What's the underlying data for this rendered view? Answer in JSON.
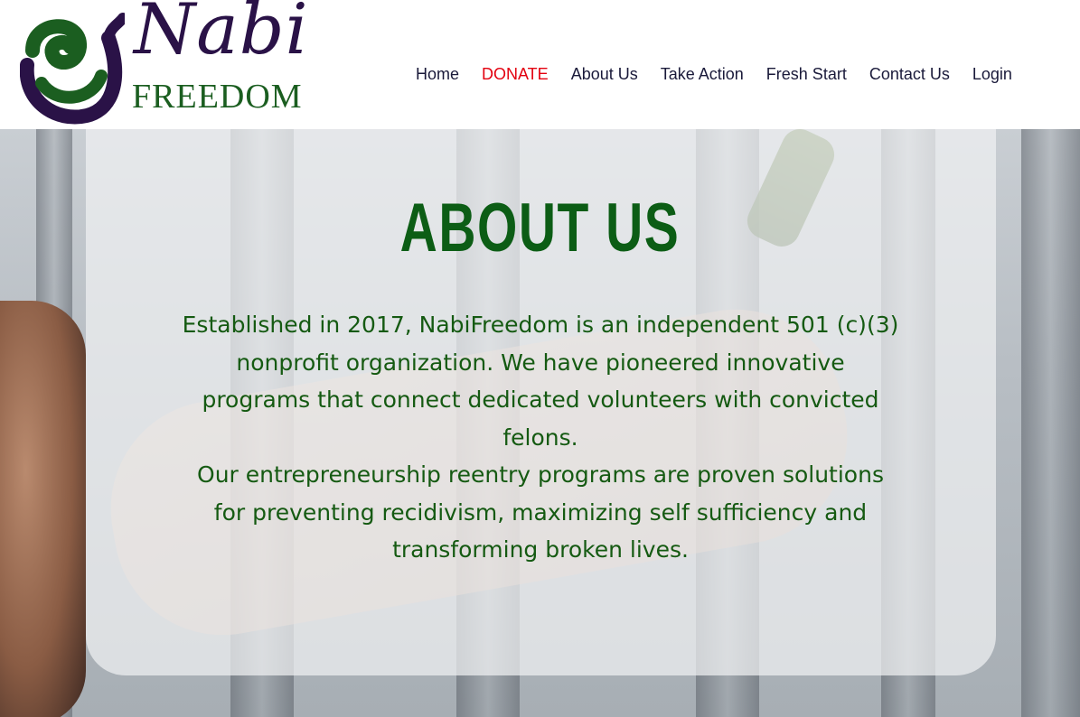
{
  "header": {
    "logo": {
      "name_top": "Nabi",
      "name_bottom": "FREEDOM"
    },
    "nav": [
      {
        "label": "Home",
        "color": "#1a1a3a"
      },
      {
        "label": "DONATE",
        "color": "#e3000f"
      },
      {
        "label": "About Us",
        "color": "#1a1a3a"
      },
      {
        "label": "Take Action",
        "color": "#1a1a3a"
      },
      {
        "label": "Fresh Start",
        "color": "#1a1a3a"
      },
      {
        "label": "Contact Us",
        "color": "#1a1a3a"
      },
      {
        "label": "Login",
        "color": "#1a1a3a"
      }
    ]
  },
  "hero": {
    "title": "ABOUT US",
    "paragraph_1": "Established in 2017, NabiFreedom is an independent 501 (c)(3) nonprofit organization. We have pioneered innovative programs that connect dedicated volunteers with convicted felons.",
    "paragraph_2": "Our entrepreneurship reentry programs are proven solutions for preventing recidivism, maximizing self sufficiency and transforming broken lives.",
    "title_color": "#0c5d15",
    "text_color": "#155a12"
  }
}
